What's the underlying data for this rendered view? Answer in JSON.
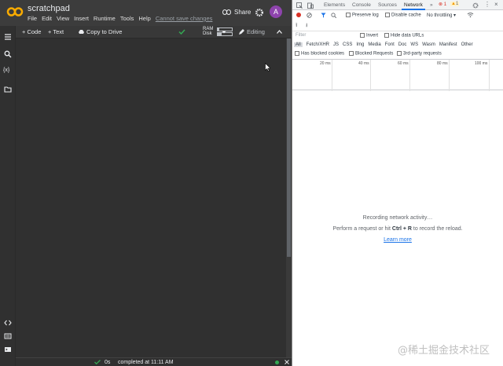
{
  "colab": {
    "notebook_title": "scratchpad",
    "menu": [
      "File",
      "Edit",
      "View",
      "Insert",
      "Runtime",
      "Tools",
      "Help"
    ],
    "save_status": "Cannot save changes",
    "share_label": "Share",
    "avatar_letter": "A",
    "toolbar": {
      "add_code": "+ Code",
      "add_text": "+ Text",
      "copy_to_drive": "Copy to Drive",
      "ram_label": "RAM",
      "disk_label": "Disk",
      "ram_fraction": 0.1,
      "disk_fraction": 0.3,
      "editing_label": "Editing"
    },
    "status": {
      "duration": "0s",
      "completed": "completed at 11:11 AM"
    },
    "colors": {
      "accent_logo": "#f9ab00",
      "avatar": "#8e44ad",
      "ok": "#34a853"
    }
  },
  "devtools": {
    "tabs": [
      "Elements",
      "Console",
      "Sources",
      "Network"
    ],
    "active_tab": "Network",
    "more_tabs": "»",
    "error_count": "1",
    "warning_count": "1",
    "network_toolbar": {
      "preserve_log": "Preserve log",
      "disable_cache": "Disable cache",
      "throttling": "No throttling"
    },
    "filter_placeholder": "Filter",
    "invert": "Invert",
    "hide_data_urls": "Hide data URLs",
    "types": [
      "All",
      "Fetch/XHR",
      "JS",
      "CSS",
      "Img",
      "Media",
      "Font",
      "Doc",
      "WS",
      "Wasm",
      "Manifest",
      "Other"
    ],
    "has_blocked_cookies": "Has blocked cookies",
    "blocked_requests": "Blocked Requests",
    "third_party": "3rd-party requests",
    "timeline_ticks": [
      "20 ms",
      "40 ms",
      "60 ms",
      "80 ms",
      "100 ms"
    ],
    "empty_state": {
      "line1": "Recording network activity…",
      "line2_pre": "Perform a request or hit ",
      "line2_key": "Ctrl + R",
      "line2_post": " to record the reload.",
      "learn_more": "Learn more"
    }
  },
  "watermark": "@稀土掘金技术社区"
}
